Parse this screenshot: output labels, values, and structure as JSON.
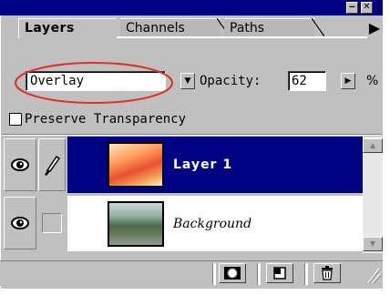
{
  "window": {
    "minimize_label": "‒",
    "close_label": "✕"
  },
  "tabs": [
    {
      "label": "Layers",
      "active": true
    },
    {
      "label": "Channels",
      "active": false
    },
    {
      "label": "Paths",
      "active": false
    }
  ],
  "palette_menu_icon": "right-triangle-icon",
  "palette_menu_glyph": "▶",
  "blend": {
    "mode_value": "Overlay",
    "dropdown_glyph": "▼",
    "opacity_label": "Opacity:",
    "opacity_value": "62",
    "opacity_arrow_glyph": "▶",
    "opacity_unit": "%"
  },
  "preserve_transparency": {
    "label": "Preserve Transparency",
    "checked": false
  },
  "layers": [
    {
      "name": "Layer 1",
      "visible": true,
      "selected": true,
      "brush_glyph": "𝒷"
    },
    {
      "name": "Background",
      "visible": true,
      "selected": false
    }
  ],
  "eye_glyph": "◉",
  "brush_glyph": "∕",
  "scroll_up_glyph": "▲",
  "scroll_down_glyph": "▼",
  "bottom_buttons": [
    {
      "icon": "mask-icon",
      "glyph": "◎"
    },
    {
      "icon": "new-layer-icon",
      "glyph": "▣"
    },
    {
      "icon": "trash-icon",
      "glyph": "⌂"
    }
  ],
  "colors": {
    "title_bar": "#000082",
    "panel_bg": "#c0c0c0",
    "selected_row": "#000082",
    "annotation_circle": "#e03020"
  }
}
